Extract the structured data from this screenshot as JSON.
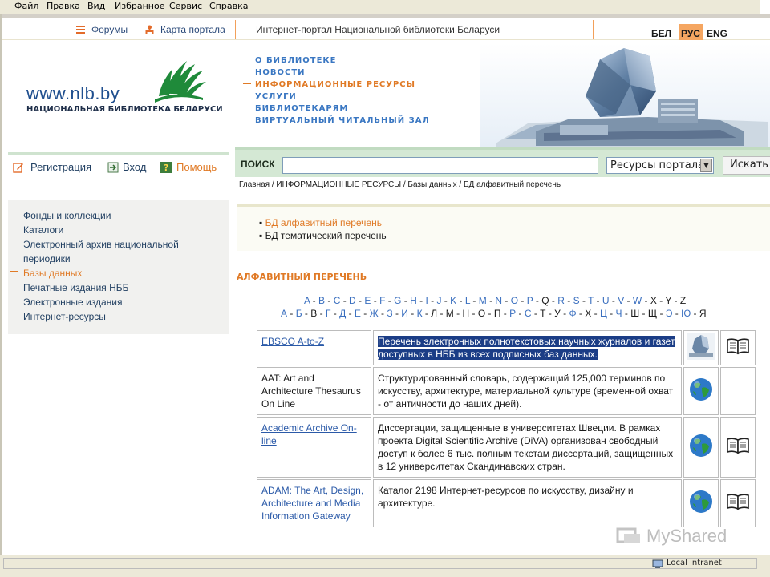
{
  "browser": {
    "menu": [
      "Файл",
      "Правка",
      "Вид",
      "Избранное",
      "Сервис",
      "Справка"
    ],
    "status_zone": "Local intranet"
  },
  "topbar": {
    "forums": "Форумы",
    "sitemap": "Карта портала",
    "portal_title": "Интернет-портал Национальной библиотеки Беларуси",
    "languages": [
      "БЕЛ",
      "РУС",
      "ENG"
    ],
    "active_language": "РУС"
  },
  "logo": {
    "url": "www.nlb.by",
    "subtitle": "НАЦИОНАЛЬНАЯ БИБЛИОТЕКА БЕЛАРУСИ"
  },
  "main_nav": [
    {
      "label": "О БИБЛИОТЕКЕ",
      "active": false
    },
    {
      "label": "НОВОСТИ",
      "active": false
    },
    {
      "label": "ИНФОРМАЦИОННЫЕ РЕСУРСЫ",
      "active": true
    },
    {
      "label": "УСЛУГИ",
      "active": false
    },
    {
      "label": "БИБЛИОТЕКАРЯМ",
      "active": false
    },
    {
      "label": "ВИРТУАЛЬНЫЙ ЧИТАЛЬНЫЙ ЗАЛ",
      "active": false
    }
  ],
  "userbar": {
    "register": "Регистрация",
    "login": "Вход",
    "help": "Помощь"
  },
  "left_menu": [
    {
      "label": "Фонды и коллекции",
      "active": false
    },
    {
      "label": "Каталоги",
      "active": false
    },
    {
      "label": "Электронный архив национальной периодики",
      "active": false
    },
    {
      "label": "Базы данных",
      "active": true
    },
    {
      "label": "Печатные издания НББ",
      "active": false
    },
    {
      "label": "Электронные издания",
      "active": false
    },
    {
      "label": "Интернет-ресурсы",
      "active": false
    }
  ],
  "search": {
    "label": "ПОИСК",
    "value": "",
    "scope": "Ресурсы портала",
    "button": "Искать"
  },
  "breadcrumb": {
    "items": [
      "Главная",
      "ИНФОРМАЦИОННЫЕ РЕСУРСЫ",
      "Базы данных"
    ],
    "current": "БД алфавитный перечень",
    "separator": " / "
  },
  "subnav": [
    {
      "label": "БД алфавитный перечень",
      "active": true
    },
    {
      "label": "БД тематический перечень",
      "active": false
    }
  ],
  "section_title": "АЛФАВИТНЫЙ ПЕРЕЧЕНЬ",
  "alphabet_latin": [
    "A",
    "B",
    "C",
    "D",
    "E",
    "F",
    "G",
    "H",
    "I",
    "J",
    "K",
    "L",
    "M",
    "N",
    "O",
    "P",
    "Q",
    "R",
    "S",
    "T",
    "U",
    "V",
    "W",
    "X",
    "Y",
    "Z"
  ],
  "alphabet_latin_plain": [
    "X",
    "Y",
    "Z",
    "Q"
  ],
  "alphabet_cyrillic": [
    "А",
    "Б",
    "В",
    "Г",
    "Д",
    "Е",
    "Ж",
    "З",
    "И",
    "К",
    "Л",
    "М",
    "Н",
    "О",
    "П",
    "Р",
    "С",
    "Т",
    "У",
    "Ф",
    "Х",
    "Ц",
    "Ч",
    "Ш",
    "Щ",
    "Э",
    "Ю",
    "Я"
  ],
  "alphabet_cyrillic_plain": [
    "В",
    "Л",
    "М",
    "Н",
    "О",
    "П",
    "Т",
    "У",
    "Х",
    "Ш",
    "Щ",
    "Я"
  ],
  "databases": [
    {
      "name": "EBSCO A-to-Z",
      "name_style": "link",
      "description": "Перечень электронных полнотекстовых научных журналов и газет доступных в НББ из всех подписных баз данных.",
      "selected": true,
      "icon": "building-icon",
      "has_book": true
    },
    {
      "name": "AAT: Art and Architecture Thesaurus On Line",
      "name_style": "plain",
      "description": "Структурированный словарь, содержащий 125,000 терминов по искусству, архитектуре, материальной культуре (временной охват - от античности до наших дней).",
      "selected": false,
      "icon": "globe-icon",
      "has_book": false
    },
    {
      "name": "Academic Archive On-line",
      "name_style": "link",
      "description": "Диссертации, защищенные в университетах Швеции. В рамках проекта Digital Scientific Archive (DiVA) организован свободный доступ к более 6 тыс. полным текстам диссертаций, защищенных в 12 университетах Скандинавских стран.",
      "selected": false,
      "icon": "globe-icon",
      "has_book": true
    },
    {
      "name": "ADAM: The Art, Design, Architecture and Media Information Gateway",
      "name_style": "blue",
      "description": "Каталог 2198 Интернет-ресурсов по искусству, дизайну и архитектуре.",
      "selected": false,
      "icon": "globe-icon",
      "has_book": true
    }
  ],
  "watermark": "MyShared",
  "colors": {
    "accent_orange": "#e07a26",
    "link_blue": "#2b5aa8",
    "nav_blue": "#3a77c2",
    "search_green": "#d4e8d4"
  }
}
